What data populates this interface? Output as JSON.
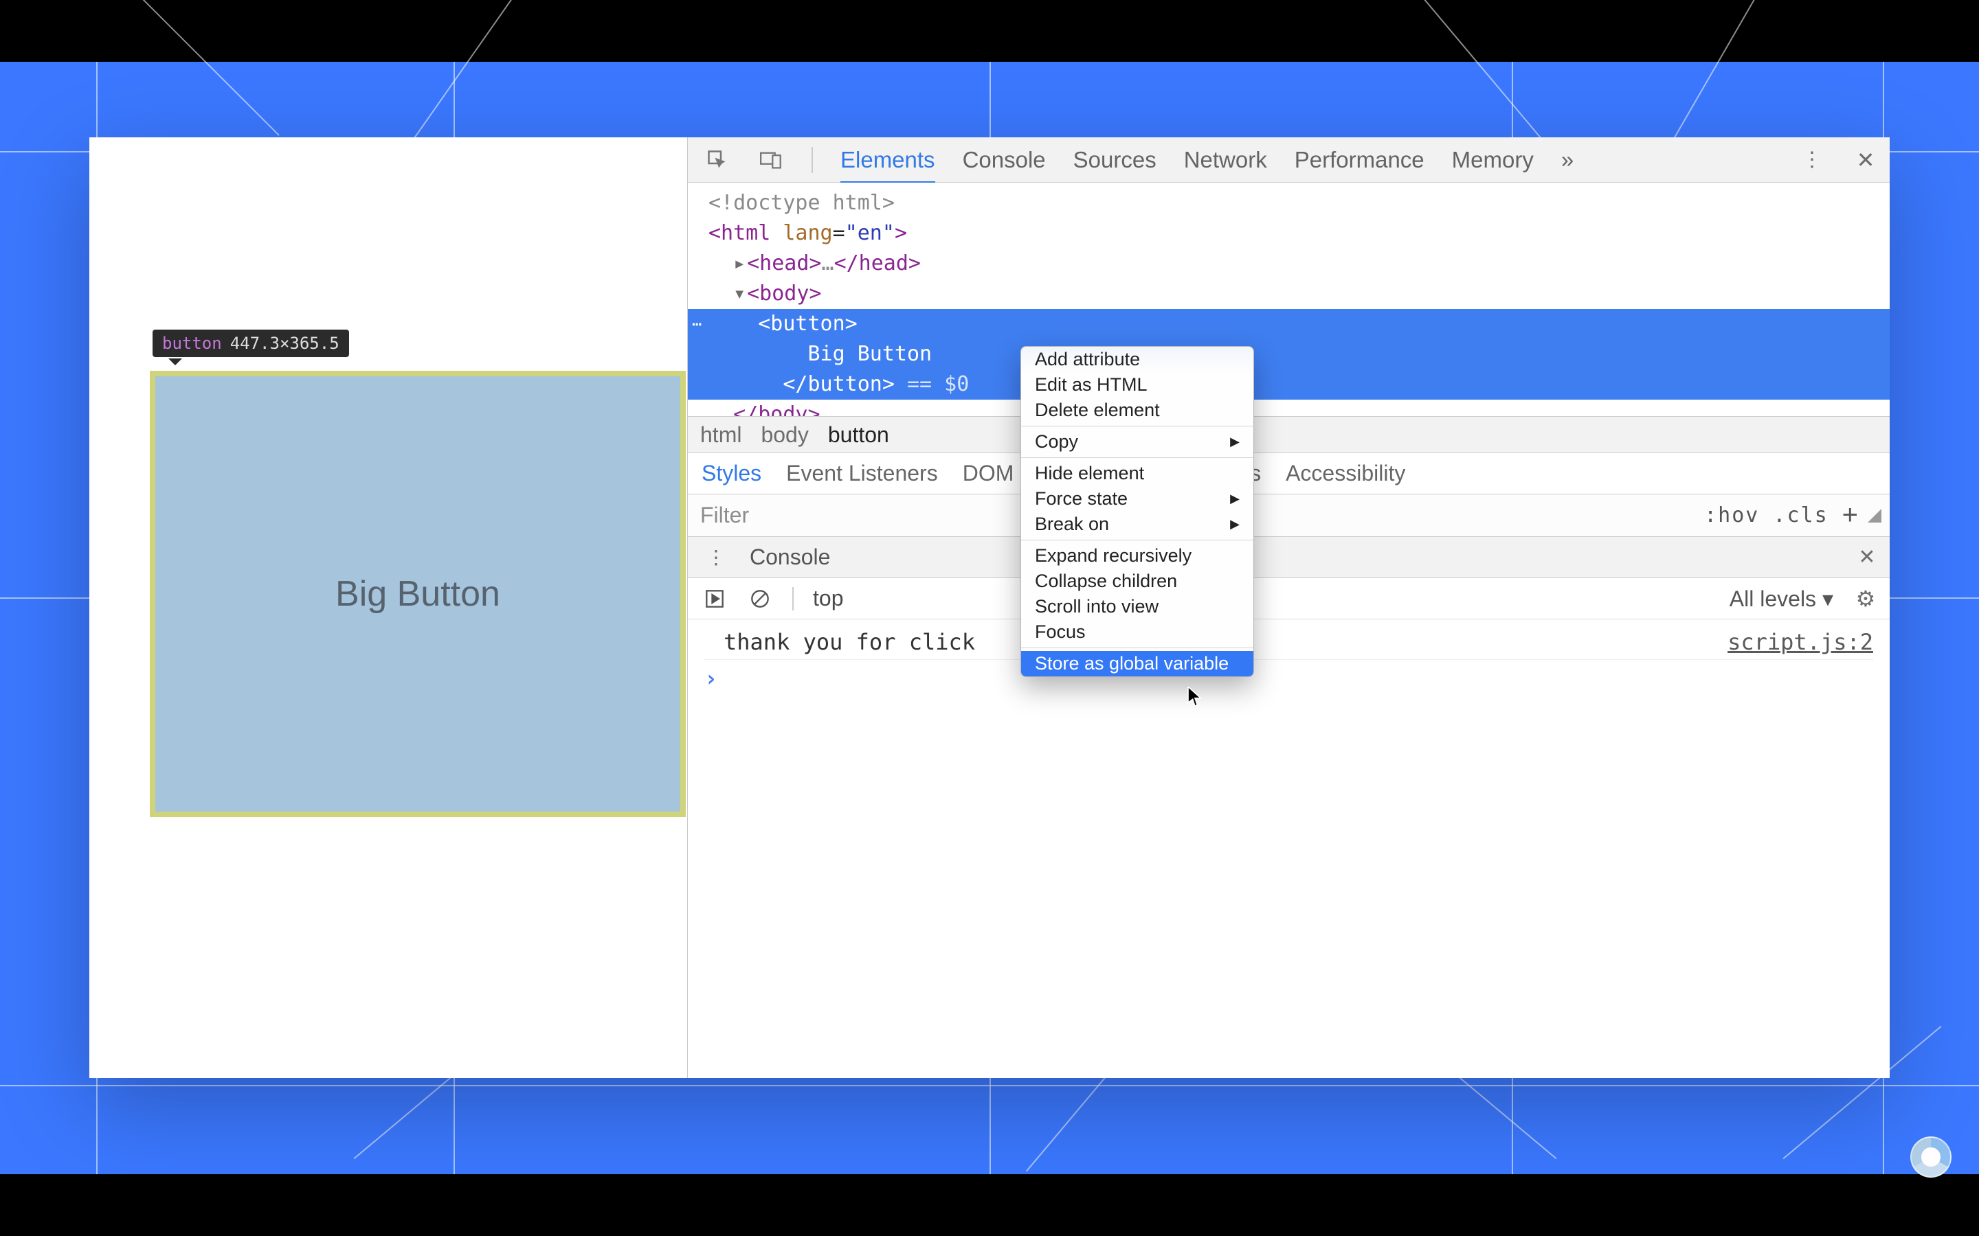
{
  "tooltip": {
    "tag": "button",
    "dims": "447.3×365.5"
  },
  "page": {
    "big_button_label": "Big Button"
  },
  "devtools": {
    "tabs": [
      "Elements",
      "Console",
      "Sources",
      "Network",
      "Performance",
      "Memory"
    ],
    "active_tab": "Elements",
    "more": "»",
    "dom": {
      "doctype": "<!doctype html>",
      "html_open": "<html ",
      "html_attr_name": "lang",
      "html_attr_val": "\"en\"",
      "html_open_end": ">",
      "head_open": "<head>",
      "head_ell": "…",
      "head_close": "</head>",
      "body_open": "<body>",
      "btn_open": "<button>",
      "btn_text": "Big Button",
      "btn_close": "</button>",
      "eq0": " == $0",
      "body_close": "</body>"
    },
    "crumbs": [
      "html",
      "body",
      "button"
    ],
    "style_tabs": [
      "Styles",
      "Event Listeners",
      "DOM Breakpoints",
      "Properties",
      "Accessibility"
    ],
    "active_style_tab": "Styles",
    "filter_placeholder": "Filter",
    "filter_right": ":hov  .cls",
    "drawer": {
      "title": "Console",
      "context": "top",
      "levels": "All levels ▾",
      "log_msg": "thank you for click",
      "src": "script.js:2"
    }
  },
  "context_menu": {
    "items": [
      {
        "label": "Add attribute",
        "sub": false
      },
      {
        "label": "Edit as HTML",
        "sub": false
      },
      {
        "label": "Delete element",
        "sub": false
      },
      {
        "sep": true
      },
      {
        "label": "Copy",
        "sub": true
      },
      {
        "sep": true
      },
      {
        "label": "Hide element",
        "sub": false
      },
      {
        "label": "Force state",
        "sub": true
      },
      {
        "label": "Break on",
        "sub": true
      },
      {
        "sep": true
      },
      {
        "label": "Expand recursively",
        "sub": false
      },
      {
        "label": "Collapse children",
        "sub": false
      },
      {
        "label": "Scroll into view",
        "sub": false
      },
      {
        "label": "Focus",
        "sub": false
      },
      {
        "sep": true
      },
      {
        "label": "Store as global variable",
        "sub": false,
        "selected": true
      }
    ]
  }
}
